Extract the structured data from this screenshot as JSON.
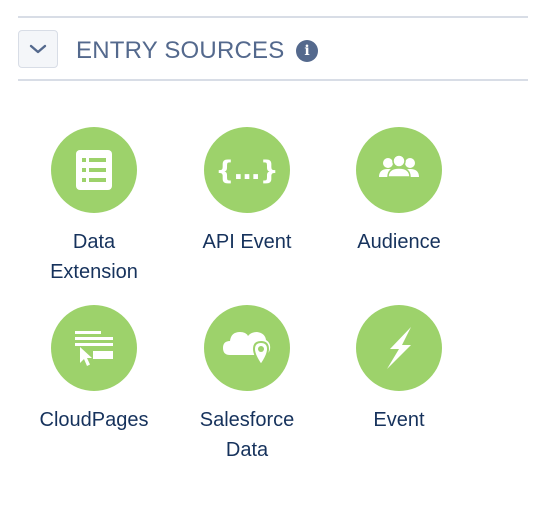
{
  "section": {
    "title": "ENTRY SOURCES",
    "toggle_icon": "chevron-down-icon",
    "info_icon": "info-icon",
    "info_glyph": "i"
  },
  "colors": {
    "tile_background": "#9dd26b",
    "tile_icon": "#ffffff",
    "title_text": "#54698d",
    "label_text": "#16325c",
    "divider": "#d8dde6"
  },
  "entry_sources": [
    {
      "label_line1": "Data",
      "label_line2": "Extension",
      "icon": "data-extension-icon"
    },
    {
      "label_line1": "API Event",
      "label_line2": "",
      "icon": "api-event-icon"
    },
    {
      "label_line1": "Audience",
      "label_line2": "",
      "icon": "audience-icon"
    },
    {
      "label_line1": "CloudPages",
      "label_line2": "",
      "icon": "cloudpages-icon"
    },
    {
      "label_line1": "Salesforce",
      "label_line2": "Data",
      "icon": "salesforce-data-icon"
    },
    {
      "label_line1": "Event",
      "label_line2": "",
      "icon": "event-icon"
    }
  ]
}
